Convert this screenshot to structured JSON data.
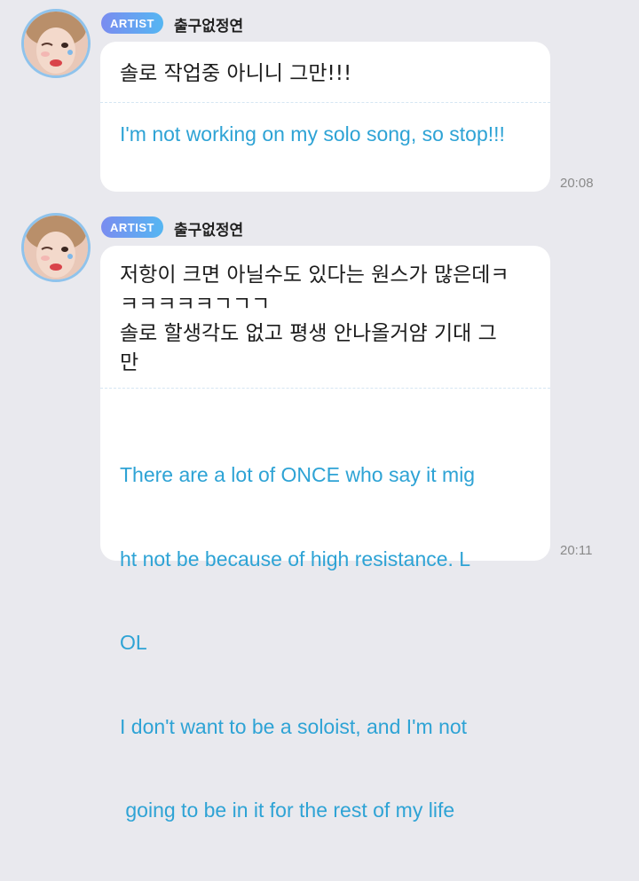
{
  "messages": [
    {
      "badge": "ARTIST",
      "author": "출구없정연",
      "original": "솔로 작업중 아니니 그만!!!",
      "translation": "I'm not working on my solo song, so stop!!!",
      "time": "20:08"
    },
    {
      "badge": "ARTIST",
      "author": "출구없정연",
      "original_lines": [
        "저항이 크면 아닐수도 있다는 원스가 많은데ㅋ",
        "ㅋㅋㅋㅋㅋㄱㄱㄱ",
        "솔로 할생각도 없고 평생 안나올거얌 기대 그",
        "만"
      ],
      "translation_lines": [
        "There are a lot of ONCE who say it mig",
        "ht not be because of high resistance. L",
        "OL",
        "I don't want to be a soloist, and I'm not",
        " going to be in it for the rest of my life"
      ],
      "time": "20:11"
    }
  ],
  "colors": {
    "background": "#e9e9ee",
    "translation": "#2ea3d5",
    "badge_start": "#7a8cf0",
    "badge_end": "#55b6f2",
    "avatar_ring": "#8fc3ec"
  }
}
